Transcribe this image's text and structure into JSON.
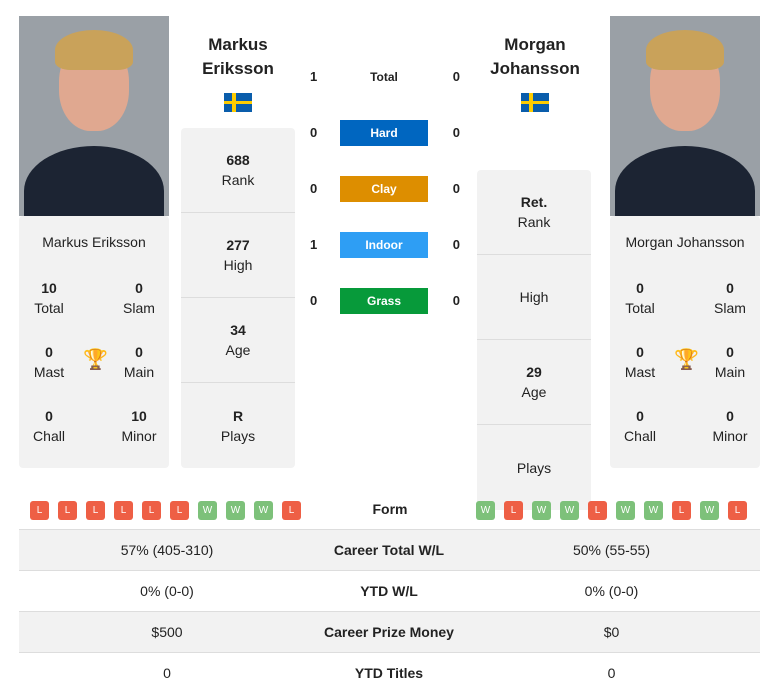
{
  "player1": {
    "name": "Markus Eriksson",
    "first": "Markus",
    "last": "Eriksson",
    "flag": "sweden-flag",
    "titles": {
      "total": "10",
      "slam": "0",
      "mast": "0",
      "main": "0",
      "chall": "0",
      "minor": "10"
    },
    "stats": [
      {
        "v": "688",
        "l": "Rank"
      },
      {
        "v": "277",
        "l": "High"
      },
      {
        "v": "34",
        "l": "Age"
      },
      {
        "v": "R",
        "l": "Plays"
      }
    ],
    "form": [
      "L",
      "L",
      "L",
      "L",
      "L",
      "L",
      "W",
      "W",
      "W",
      "L"
    ]
  },
  "player2": {
    "name": "Morgan Johansson",
    "first": "Morgan",
    "last": "Johansson",
    "flag": "sweden-flag",
    "titles": {
      "total": "0",
      "slam": "0",
      "mast": "0",
      "main": "0",
      "chall": "0",
      "minor": "0"
    },
    "stats": [
      {
        "v": "Ret.",
        "l": "Rank"
      },
      {
        "v": "",
        "l": "High"
      },
      {
        "v": "29",
        "l": "Age"
      },
      {
        "v": "",
        "l": "Plays"
      }
    ],
    "form": [
      "W",
      "L",
      "W",
      "W",
      "L",
      "W",
      "W",
      "L",
      "W",
      "L"
    ]
  },
  "labels": {
    "total": "Total",
    "slam": "Slam",
    "mast": "Mast",
    "main": "Main",
    "chall": "Chall",
    "minor": "Minor",
    "form": "Form"
  },
  "h2h": [
    {
      "s": "Total",
      "l": "1",
      "r": "0",
      "c": ""
    },
    {
      "s": "Hard",
      "l": "0",
      "r": "0",
      "c": "#0066c0"
    },
    {
      "s": "Clay",
      "l": "0",
      "r": "0",
      "c": "#dd8e00"
    },
    {
      "s": "Indoor",
      "l": "1",
      "r": "0",
      "c": "#2e9ef4"
    },
    {
      "s": "Grass",
      "l": "0",
      "r": "0",
      "c": "#079a3a"
    }
  ],
  "colors": {
    "win": "#7dc17a",
    "loss": "#ee5f45"
  },
  "table": [
    {
      "a": "57% (405-310)",
      "m": "Career Total W/L",
      "b": "50% (55-55)"
    },
    {
      "a": "0% (0-0)",
      "m": "YTD W/L",
      "b": "0% (0-0)"
    },
    {
      "a": "$500",
      "m": "Career Prize Money",
      "b": "$0"
    },
    {
      "a": "0",
      "m": "YTD Titles",
      "b": "0"
    }
  ]
}
